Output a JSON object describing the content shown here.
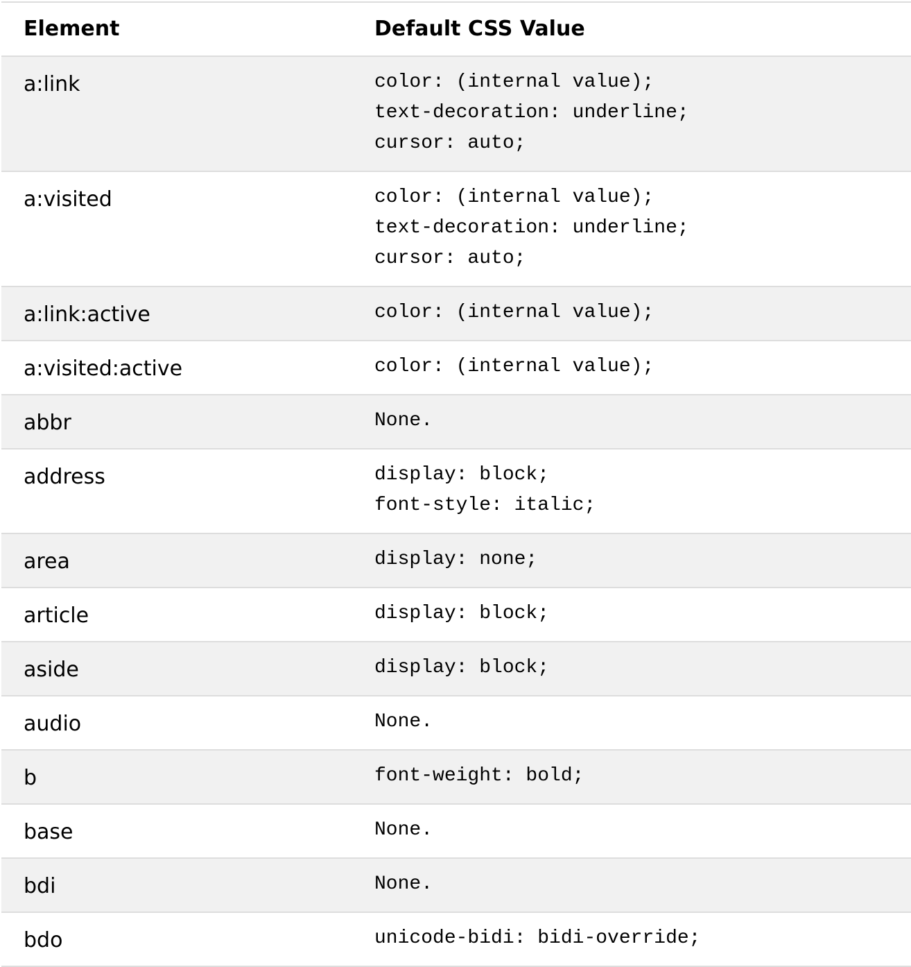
{
  "table": {
    "headers": {
      "element": "Element",
      "value": "Default CSS Value"
    },
    "rows": [
      {
        "element": "a:link",
        "value": [
          "color: (internal value);",
          "text-decoration: underline;",
          "cursor: auto;"
        ]
      },
      {
        "element": "a:visited",
        "value": [
          "color: (internal value);",
          "text-decoration: underline;",
          "cursor: auto;"
        ]
      },
      {
        "element": "a:link:active",
        "value": [
          "color: (internal value);"
        ]
      },
      {
        "element": "a:visited:active",
        "value": [
          "color: (internal value);"
        ]
      },
      {
        "element": "abbr",
        "value": [
          "None."
        ]
      },
      {
        "element": "address",
        "value": [
          "display: block;",
          "font-style: italic;"
        ]
      },
      {
        "element": "area",
        "value": [
          "display: none;"
        ]
      },
      {
        "element": "article",
        "value": [
          "display: block;"
        ]
      },
      {
        "element": "aside",
        "value": [
          "display: block;"
        ]
      },
      {
        "element": "audio",
        "value": [
          "None."
        ]
      },
      {
        "element": "b",
        "value": [
          "font-weight: bold;"
        ]
      },
      {
        "element": "base",
        "value": [
          "None."
        ]
      },
      {
        "element": "bdi",
        "value": [
          "None."
        ]
      },
      {
        "element": "bdo",
        "value": [
          "unicode-bidi: bidi-override;"
        ]
      }
    ]
  }
}
